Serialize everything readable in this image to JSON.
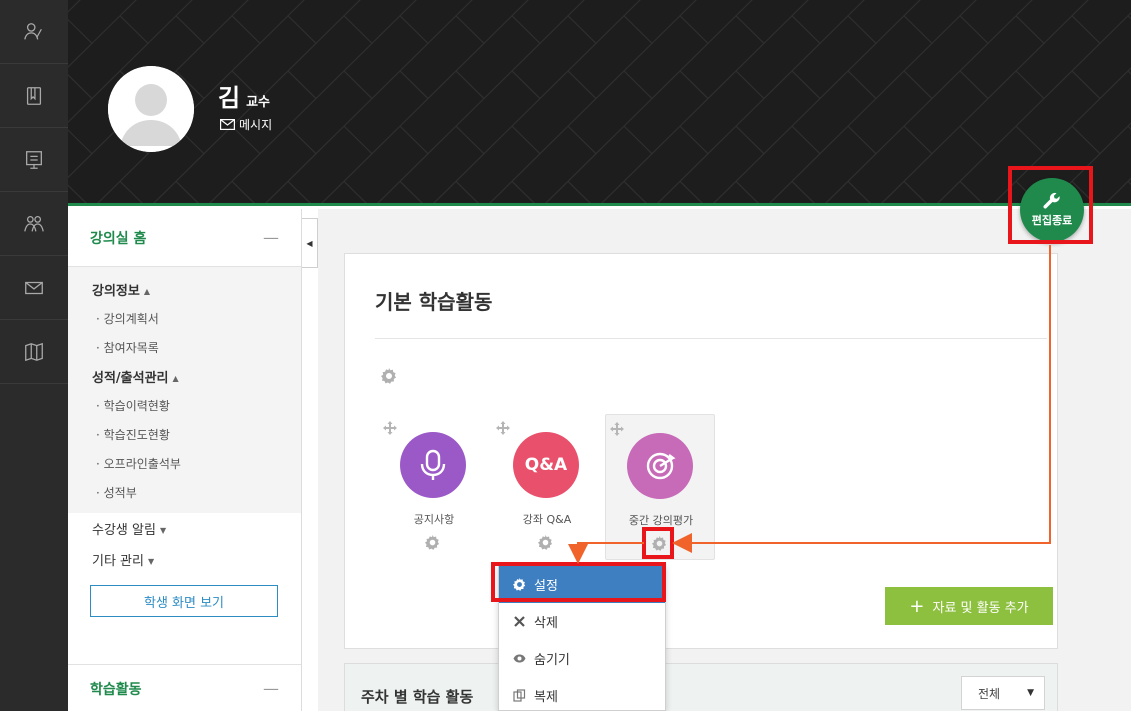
{
  "header": {
    "professor_name": "김",
    "professor_rank": "교수",
    "message_label": "메시지"
  },
  "edit_button": {
    "label": "편집종료"
  },
  "nav": {
    "home_label": "강의실 홈",
    "collapse_symbol": "—",
    "group1": {
      "title": "강의정보",
      "items": [
        "강의계획서",
        "참여자목록"
      ]
    },
    "group2": {
      "title": "성적/출석관리",
      "items": [
        "학습이력현황",
        "학습진도현황",
        "오프라인출석부",
        "성적부"
      ]
    },
    "student_alert": "수강생 알림",
    "other_manage": "기타 관리",
    "student_view_button": "학생 화면 보기",
    "learning_label": "학습활동"
  },
  "main": {
    "section_title": "기본 학습활동",
    "activities": [
      {
        "label": "공지사항",
        "icon": "microphone-icon",
        "color": "#9b59c7"
      },
      {
        "label": "강좌 Q&A",
        "icon_text": "Q&A",
        "color": "#e9506b"
      },
      {
        "label": "중간 강의평가",
        "icon": "target-icon",
        "color": "#c76ab8"
      }
    ],
    "add_button": "자료 및 활동 추가",
    "weekly_title": "주차 별 학습 활동",
    "filter_value": "전체"
  },
  "menu": {
    "items": [
      {
        "label": "설정",
        "icon": "gear-icon"
      },
      {
        "label": "삭제",
        "icon": "x-icon"
      },
      {
        "label": "숨기기",
        "icon": "eye-icon"
      },
      {
        "label": "복제",
        "icon": "copy-icon"
      }
    ]
  },
  "colors": {
    "brand_green": "#1f8a4c",
    "highlight_red": "#e8151b",
    "arrow_orange": "#f0642b",
    "menu_selected": "#3d7fc1",
    "add_green": "#8dc03f"
  }
}
